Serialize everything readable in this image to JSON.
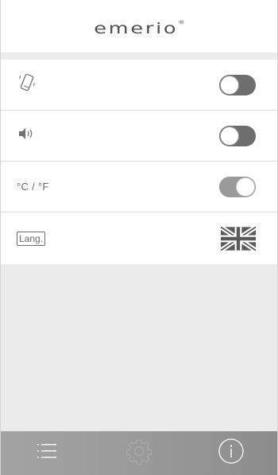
{
  "header": {
    "logo_text": "emerio",
    "logo_mark": "®"
  },
  "settings": {
    "rows": [
      {
        "icon": "phone-vibrate-icon",
        "control": "toggle",
        "state": "off"
      },
      {
        "icon": "speaker-sound-icon",
        "control": "toggle",
        "state": "off"
      },
      {
        "label": "°C / °F",
        "control": "toggle",
        "state": "on"
      },
      {
        "label": "Lang.",
        "control": "language",
        "value_icon": "uk-flag-icon"
      }
    ]
  },
  "footer": {
    "buttons": [
      {
        "icon": "list-menu-icon"
      },
      {
        "icon": "gear-icon"
      },
      {
        "icon": "info-icon"
      }
    ]
  },
  "colors": {
    "toggle_off": "#6e6e6e",
    "toggle_on": "#9a9a9a",
    "footer": "#9a9a9a",
    "background": "#ebebeb"
  }
}
